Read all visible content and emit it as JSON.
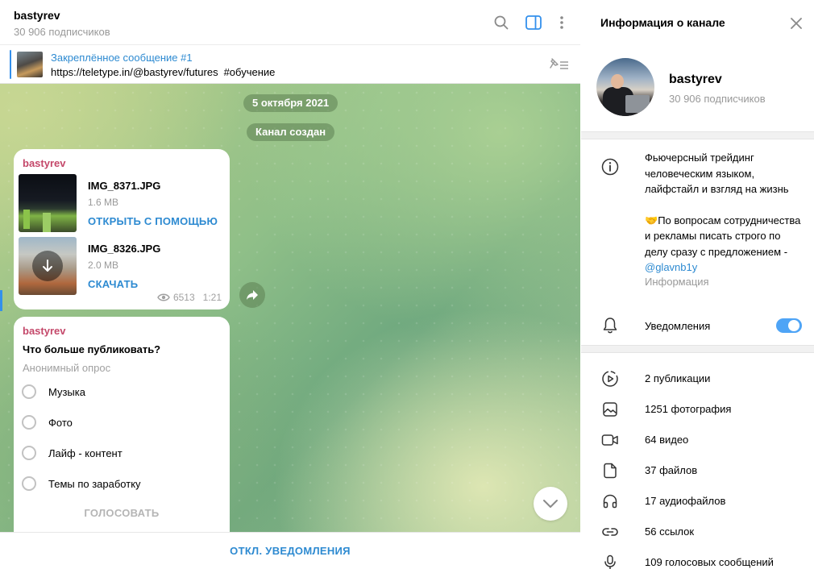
{
  "chat": {
    "title": "bastyrev",
    "subscribers": "30 906 подписчиков",
    "pinned": {
      "title": "Закреплённое сообщение #1",
      "link": "https://teletype.in/@bastyrev/futures",
      "tag": "#обучение"
    },
    "date_pill": "5 октября 2021",
    "created_pill": "Канал создан",
    "files_message": {
      "author": "bastyrev",
      "files": [
        {
          "name": "IMG_8371.JPG",
          "size": "1.6 MB",
          "action": "ОТКРЫТЬ С ПОМОЩЬЮ"
        },
        {
          "name": "IMG_8326.JPG",
          "size": "2.0 MB",
          "action": "СКАЧАТЬ"
        }
      ],
      "views": "6513",
      "time": "1:21"
    },
    "poll": {
      "author": "bastyrev",
      "question": "Что больше публиковать?",
      "type": "Анонимный опрос",
      "options": [
        "Музыка",
        "Фото",
        "Лайф - контент",
        "Темы по заработку"
      ],
      "vote_label": "ГОЛОСОВАТЬ"
    },
    "mute_label": "ОТКЛ. УВЕДОМЛЕНИЯ"
  },
  "info_panel": {
    "title": "Информация о канале",
    "name": "bastyrev",
    "subscribers": "30 906 подписчиков",
    "description_1": "Фьючерсный трейдинг человеческим языком, лайфстайл и взгляд на жизнь",
    "description_2_emoji": "🤝",
    "description_2": "По вопросам сотрудничества и рекламы писать строго по делу сразу с предложением - ",
    "description_link": "@glavnb1y",
    "description_label": "Информация",
    "notifications_label": "Уведомления",
    "notifications_on": true,
    "stats": [
      {
        "icon": "publications-icon",
        "label": "2 публикации"
      },
      {
        "icon": "photo-icon",
        "label": "1251 фотография"
      },
      {
        "icon": "video-icon",
        "label": "64 видео"
      },
      {
        "icon": "file-icon",
        "label": "37 файлов"
      },
      {
        "icon": "headphones-icon",
        "label": "17 аудиофайлов"
      },
      {
        "icon": "link-icon",
        "label": "56 ссылок"
      },
      {
        "icon": "microphone-icon",
        "label": "109 голосовых сообщений"
      }
    ]
  },
  "colors": {
    "accent": "#2d8ad1",
    "author": "#c4486a",
    "toggle": "#4ea4f6",
    "muted_text": "#999999"
  }
}
